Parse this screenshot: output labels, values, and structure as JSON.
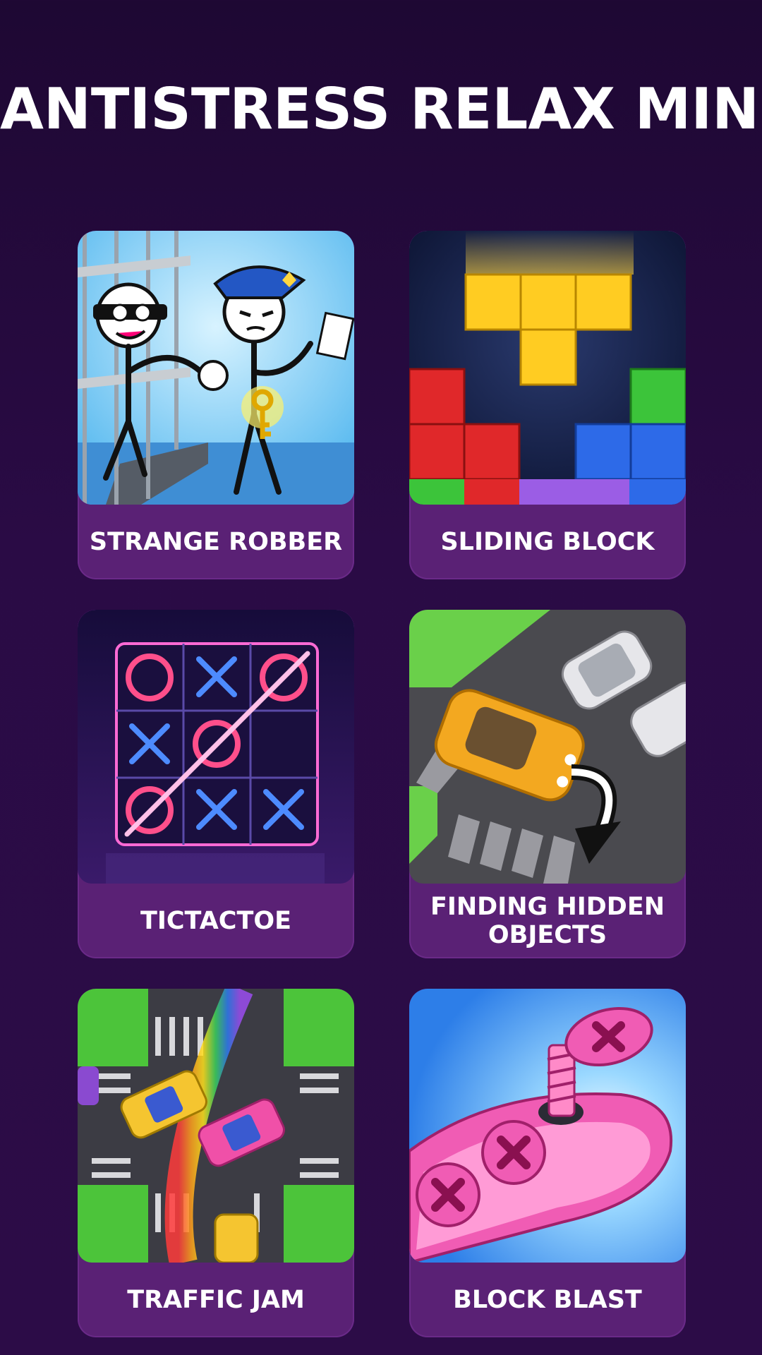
{
  "app": {
    "title": "ANTISTRESS RELAX MINI"
  },
  "games": [
    {
      "label": "STRANGE ROBBER",
      "icon": "stickman-robber-police-icon"
    },
    {
      "label": "SLIDING BLOCK",
      "icon": "falling-blocks-icon"
    },
    {
      "label": "TICTACTOE",
      "icon": "neon-tictactoe-icon"
    },
    {
      "label": "FINDING HIDDEN OBJECTS",
      "icon": "parking-car-icon"
    },
    {
      "label": "TRAFFIC JAM",
      "icon": "rainbow-traffic-icon"
    },
    {
      "label": "BLOCK BLAST",
      "icon": "pink-screw-icon"
    }
  ],
  "colors": {
    "background": "#2a0b45",
    "card": "#5a2175",
    "text": "#ffffff"
  }
}
